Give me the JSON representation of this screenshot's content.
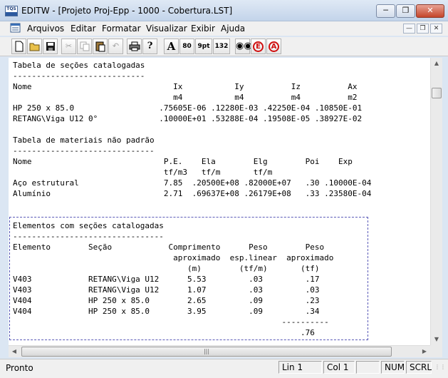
{
  "window": {
    "app_icon_label": "TQS",
    "title": "EDITW - [Projeto Proj-Epp - 1000 - Cobertura.LST]"
  },
  "menu": [
    "Arquivos",
    "Editar",
    "Formatar",
    "Visualizar",
    "Exibir",
    "Ajuda"
  ],
  "toolbar": {
    "font_button": "A",
    "size_80": "80",
    "size_9pt": "9pt",
    "size_132": "132",
    "circle_e": "E",
    "circle_a": "A"
  },
  "document": {
    "lines": [
      "Tabela de seções catalogadas",
      "----------------------------",
      "Nome                              Ix           Iy          Iz          Ax",
      "                                  m4           m4          m4          m2",
      "HP 250 x 85.0                  .75605E-06 .12280E-03 .42250E-04 .10850E-01",
      "RETANG\\Viga U12 0°             .10000E+01 .53288E-04 .19508E-05 .38927E-02",
      "",
      "Tabela de materiais não padrão",
      "------------------------------",
      "Nome                            P.E.    Ela        Elg        Poi    Exp",
      "                                tf/m3   tf/m       tf/m",
      "Aço estrutural                  7.85  .20500E+08 .82000E+07   .30 .10000E-04",
      "Alumínio                        2.71  .69637E+08 .26179E+08   .33 .23580E-04",
      "",
      "",
      "Elementos com seções catalogadas",
      "--------------------------------",
      "Elemento        Seção            Comprimento      Peso        Peso",
      "                                  aproximado  esp.linear  aproximado",
      "                                     (m)        (tf/m)       (tf)",
      "V403            RETANG\\Viga U12      5.53         .03         .17",
      "V403            RETANG\\Viga U12      1.07         .03         .03",
      "V404            HP 250 x 85.0        2.65         .09         .23",
      "V404            HP 250 x 85.0        3.95         .09         .34",
      "                                                         ----------",
      "                                                             .76"
    ]
  },
  "status": {
    "text": "Pronto",
    "line": "Lin 1",
    "col": "Col 1",
    "num": "NUM",
    "scrl": "SCRL"
  }
}
